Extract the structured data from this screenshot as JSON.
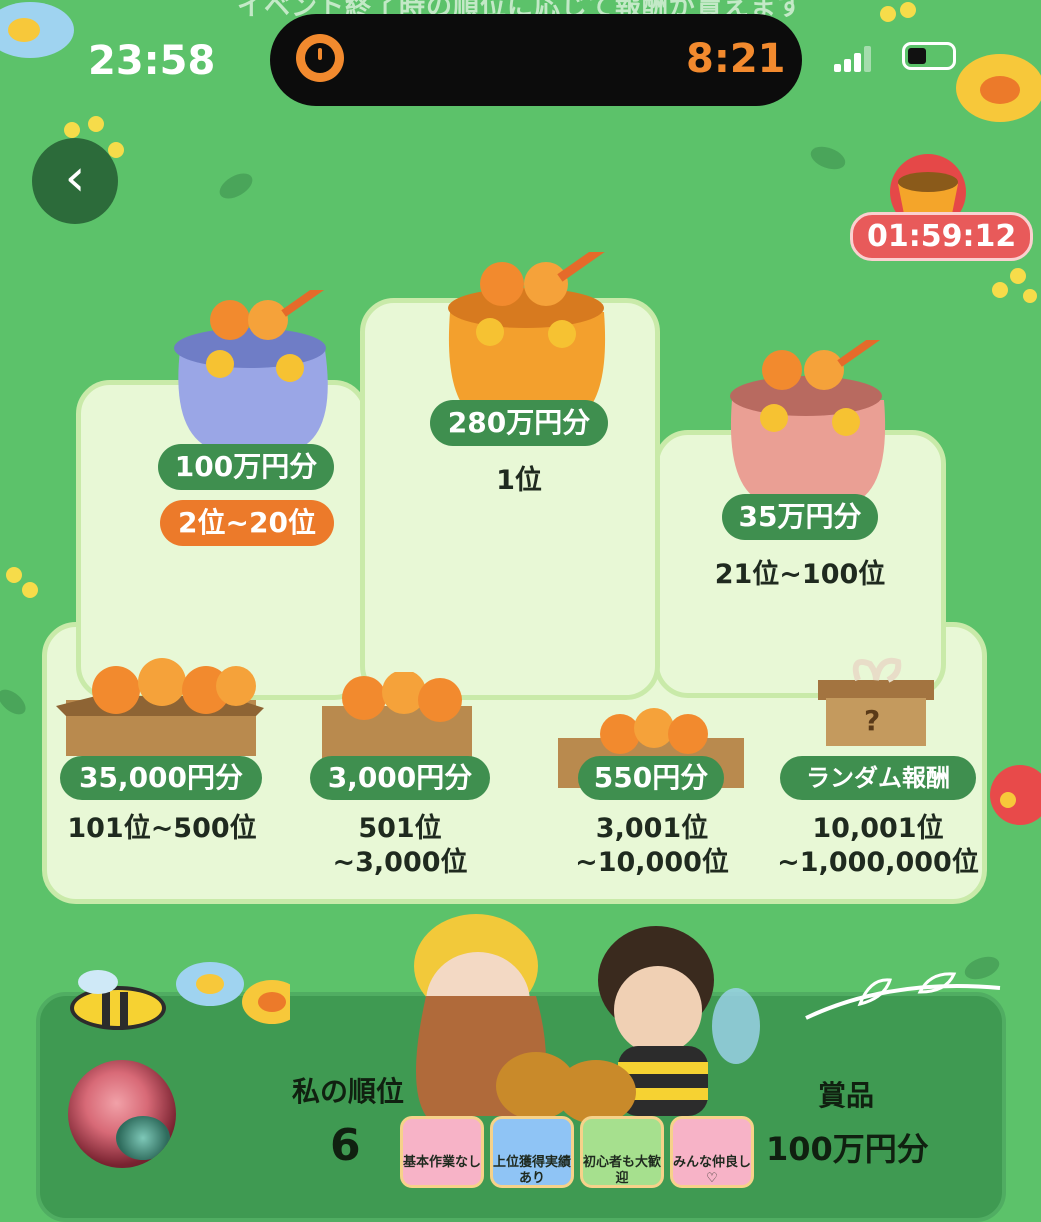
{
  "header": {
    "notice": "イベント終了時の順位に応じて報酬が貰えます",
    "status_time": "23:58",
    "island_timer": "8:21"
  },
  "nav": {
    "back_label": "‹"
  },
  "event": {
    "countdown": "01:59:12"
  },
  "podium": {
    "first": {
      "prize": "280万円分",
      "rank": "1位"
    },
    "second": {
      "prize": "100万円分",
      "rank": "2位~20位"
    },
    "third": {
      "prize": "35万円分",
      "rank": "21位~100位"
    }
  },
  "tiers": [
    {
      "prize": "35,000円分",
      "rank_line1": "101位~500位",
      "rank_line2": ""
    },
    {
      "prize": "3,000円分",
      "rank_line1": "501位",
      "rank_line2": "~3,000位"
    },
    {
      "prize": "550円分",
      "rank_line1": "3,001位",
      "rank_line2": "~10,000位"
    },
    {
      "prize": "ランダム報酬",
      "rank_line1": "10,001位",
      "rank_line2": "~1,000,000位"
    }
  ],
  "my_status": {
    "rank_label": "私の順位",
    "rank_value": "6",
    "prize_label": "賞品",
    "prize_value": "100万円分"
  },
  "tags": [
    {
      "text": "基本作業なし",
      "color": "#f7b3c7"
    },
    {
      "text": "上位獲得実績あり",
      "color": "#8fc4f5"
    },
    {
      "text": "初心者も大歓迎",
      "color": "#a6e08e"
    },
    {
      "text": "みんな仲良し♡",
      "color": "#f7b3c7"
    }
  ],
  "theme": {
    "background": "#5cc26a",
    "pill": "#3f8f4f",
    "accent_orange": "#ec7a2a",
    "countdown_red": "#e85a5a"
  }
}
